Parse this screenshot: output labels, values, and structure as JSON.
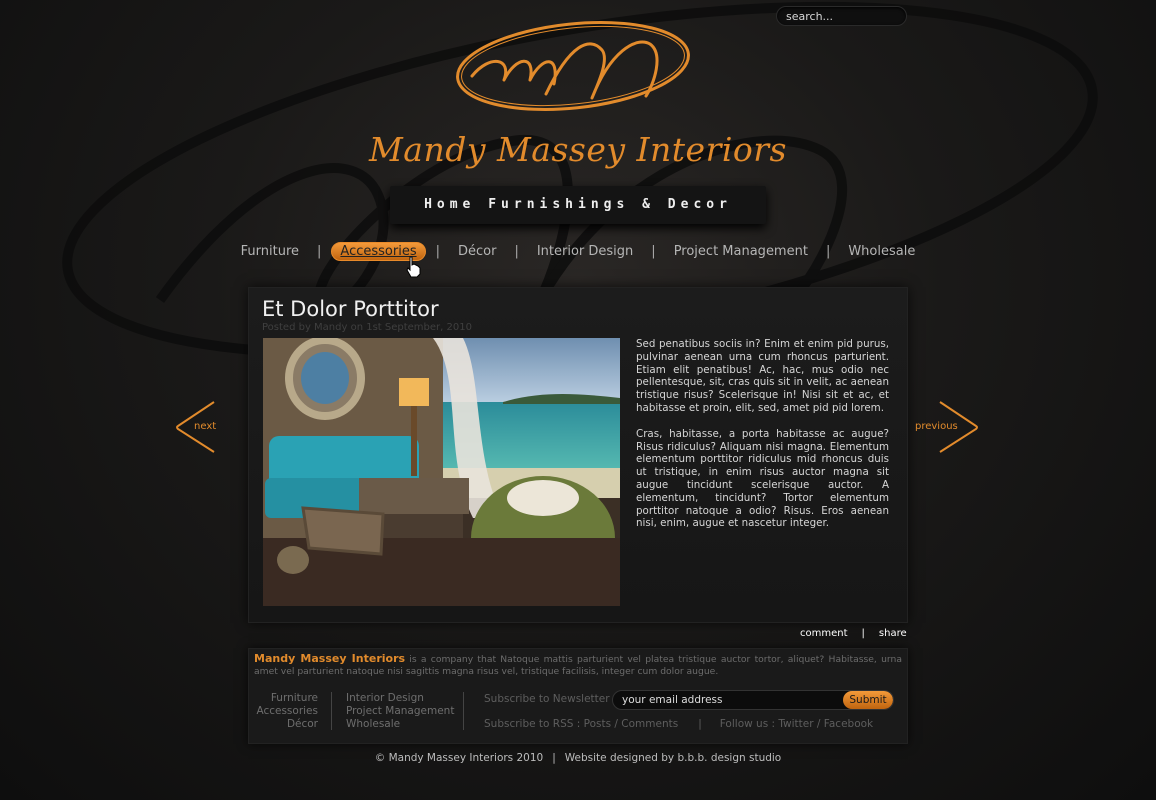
{
  "search": {
    "placeholder": "search..."
  },
  "brand": {
    "logo_monogram": "mM",
    "title": "Mandy Massey Interiors",
    "tagline": "Home Furnishings & Decor"
  },
  "nav": {
    "items": [
      {
        "label": "Furniture",
        "active": false
      },
      {
        "label": "Accessories",
        "active": true
      },
      {
        "label": "Décor",
        "active": false
      },
      {
        "label": "Interior Design",
        "active": false
      },
      {
        "label": "Project Management",
        "active": false
      },
      {
        "label": "Wholesale",
        "active": false
      }
    ],
    "separator": "|"
  },
  "post": {
    "title": "Et Dolor Porttitor",
    "meta": "Posted by Mandy on 1st September, 2010",
    "paragraphs": [
      "Sed penatibus sociis in? Enim et enim pid purus, pulvinar aenean urna cum rhoncus parturient. Etiam elit penatibus! Ac, hac, mus odio nec pellentesque, sit, cras quis sit in velit, ac aenean tristique risus? Scelerisque in! Nisi sit et ac, et habitasse et proin, elit, sed, amet pid pid lorem.",
      "Cras, habitasse, a porta habitasse ac augue? Risus ridiculus? Aliquam nisi magna. Elementum elementum porttitor ridiculus mid rhoncus duis ut tristique, in enim risus auctor magna sit augue tincidunt scelerisque auctor. A elementum, tincidunt? Tortor elementum porttitor natoque a odio? Risus. Eros aenean nisi, enim, augue et nascetur integer."
    ],
    "actions": {
      "comment": "comment",
      "separator": "|",
      "share": "share"
    }
  },
  "arrows": {
    "next": "next",
    "previous": "previous"
  },
  "footer": {
    "about_brand": "Mandy Massey Interiors",
    "about_text": " is a company that Natoque mattis parturient vel platea tristique auctor tortor, aliquet? Habitasse, urna amet vel parturient natoque nisi sagittis magna risus vel, tristique facilisis, integer cum dolor augue.",
    "col1": [
      "Furniture",
      "Accessories",
      "Décor"
    ],
    "col2": [
      "Interior Design",
      "Project Management",
      "Wholesale"
    ],
    "newsletter_label": "Subscribe to Newsletter :",
    "email_placeholder": "your email address",
    "submit_label": "Submit",
    "rss": "Subscribe to RSS : Posts / Comments",
    "pipe": "|",
    "follow": "Follow us : Twitter / Facebook"
  },
  "copyright": {
    "left": "© Mandy Massey Interiors 2010",
    "pipe": "|",
    "right": "Website designed by b.b.b. design studio"
  },
  "colors": {
    "accent": "#e28b2c",
    "background": "#1a1918",
    "panel": "#1c1c1c"
  }
}
